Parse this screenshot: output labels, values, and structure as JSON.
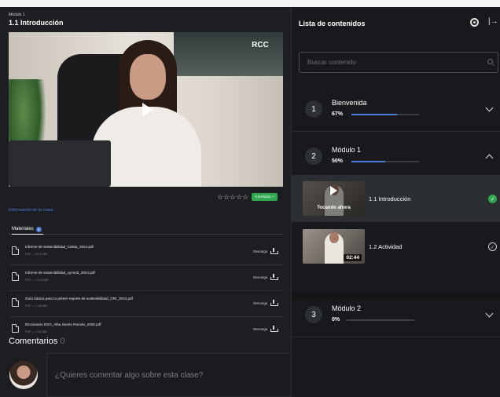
{
  "breadcrumb": "Módulo 1",
  "lesson_title": "1.1 Introducción",
  "video": {
    "logo_text": "RCC"
  },
  "rating": {
    "stars": "☆☆☆☆☆",
    "filled": 0
  },
  "completed_button": "Concluido ✓",
  "class_info_link": "Información de la clase",
  "tabs": {
    "materials_label": "Materiales",
    "materials_count": "4"
  },
  "materials": [
    {
      "name": "Informe de sostenibilidad_Celsia_2024.pdf",
      "meta": "PDF — 8.10 MB",
      "action": "Descarga"
    },
    {
      "name": "Informe de sostenibilidad_Lynxott_2024.pdf",
      "meta": "PDF — 10.10 MB",
      "action": "Descarga"
    },
    {
      "name": "Guía básica para tu primer reporte de sostenibilidad_GRI_2024.pdf",
      "meta": "PDF — 1.58 MB",
      "action": "Descarga"
    },
    {
      "name": "Diccionario ESG_Alba Sueiro Román_2025.pdf",
      "meta": "PDF — 2.52 MB",
      "action": "Descarga"
    }
  ],
  "comments": {
    "title": "Comentarios",
    "count": "0",
    "placeholder": "¿Quieres comentar algo sobre esta clase?"
  },
  "panel": {
    "title": "Lista de contenidos",
    "search_placeholder": "Buscar contenido",
    "modules": [
      {
        "number": "1",
        "title": "Bienvenida",
        "progress_label": "67%",
        "progress": 67
      },
      {
        "number": "2",
        "title": "Módulo 1",
        "progress_label": "50%",
        "progress": 50
      },
      {
        "number": "3",
        "title": "Módulo 2",
        "progress_label": "0%",
        "progress": 0
      }
    ],
    "lessons": [
      {
        "title": "1.1 Introducción",
        "badge": "Tocando ahora",
        "status": "completed"
      },
      {
        "title": "1.2 Actividad",
        "duration": "02:44",
        "status": "pending"
      }
    ]
  },
  "colors": {
    "accent": "#4d7bd6",
    "success": "#2fa84f"
  }
}
